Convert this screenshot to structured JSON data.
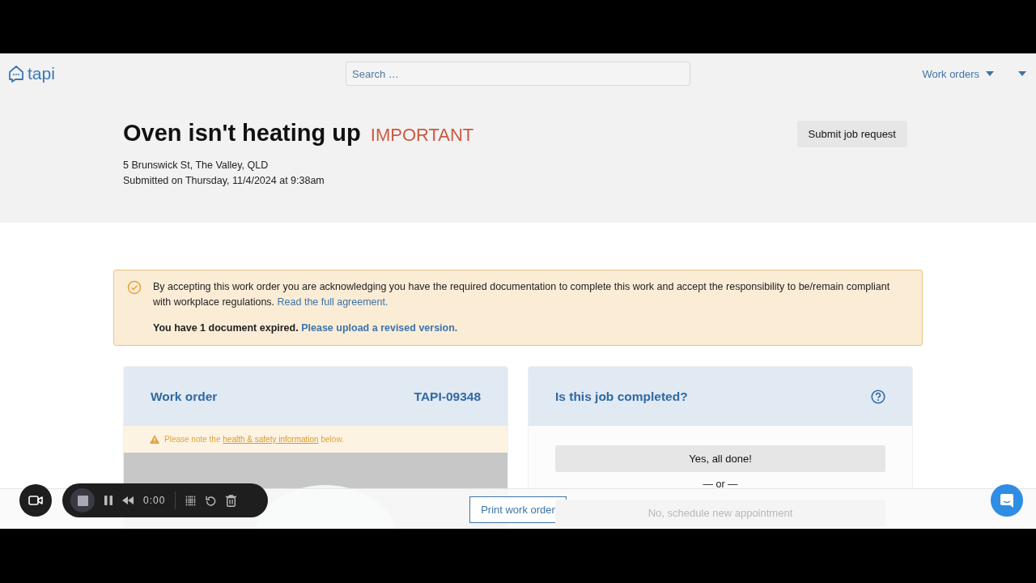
{
  "nav": {
    "logo": "tapi",
    "search": {
      "placeholder": "Search …"
    },
    "menu": "Work orders"
  },
  "job": {
    "title": "Oven isn't heating up",
    "priority": "IMPORTANT",
    "address": "5 Brunswick St, The Valley, QLD",
    "submitted": "Submitted on Thursday, 11/4/2024 at 9:38am",
    "action": "Submit job request"
  },
  "notice": {
    "text": "By accepting this work order you are acknowledging you have the required documentation to complete this work and accept the responsibility to be/remain compliant with workplace regulations.",
    "link": "Read the full agreement.",
    "warning": "You have 1 document expired.",
    "warning_link": "Please upload a revised version."
  },
  "work_order": {
    "title": "Work order",
    "number": "TAPI-09348",
    "safety": {
      "before": "Please note the",
      "link": "health & safety information",
      "after": "below."
    }
  },
  "completion": {
    "title": "Is this job completed?",
    "primary": "Yes, all done!",
    "separator": "— or —",
    "secondary": "No, schedule new appointment"
  },
  "footer": {
    "button": "Print work order"
  },
  "recorder": {
    "time": "0:00"
  }
}
